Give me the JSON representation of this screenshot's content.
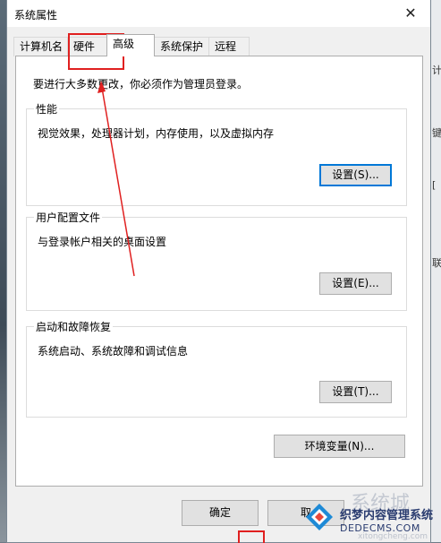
{
  "window": {
    "title": "系统属性"
  },
  "tabs": [
    {
      "label": "计算机名"
    },
    {
      "label": "硬件"
    },
    {
      "label": "高级"
    },
    {
      "label": "系统保护"
    },
    {
      "label": "远程"
    }
  ],
  "active_tab": "高级",
  "notice": "要进行大多数更改，你必须作为管理员登录。",
  "groups": {
    "performance": {
      "title": "性能",
      "description": "视觉效果，处理器计划，内存使用，以及虚拟内存",
      "button": "设置(S)..."
    },
    "user_profiles": {
      "title": "用户配置文件",
      "description": "与登录帐户相关的桌面设置",
      "button": "设置(E)..."
    },
    "startup_recovery": {
      "title": "启动和故障恢复",
      "description": "系统启动、系统故障和调试信息",
      "button": "设置(T)..."
    }
  },
  "env_button": "环境变量(N)...",
  "footer": {
    "ok": "确定",
    "cancel": "取"
  },
  "watermark": {
    "line1": "织梦内容管理系统",
    "line2": "DEDECMS.COM",
    "faint": "系统城",
    "faint2": "xitongcheng.com"
  },
  "background_right": [
    "计",
    "键",
    "[",
    "联"
  ],
  "colors": {
    "annotation": "#e02020",
    "focus": "#0078d7"
  }
}
